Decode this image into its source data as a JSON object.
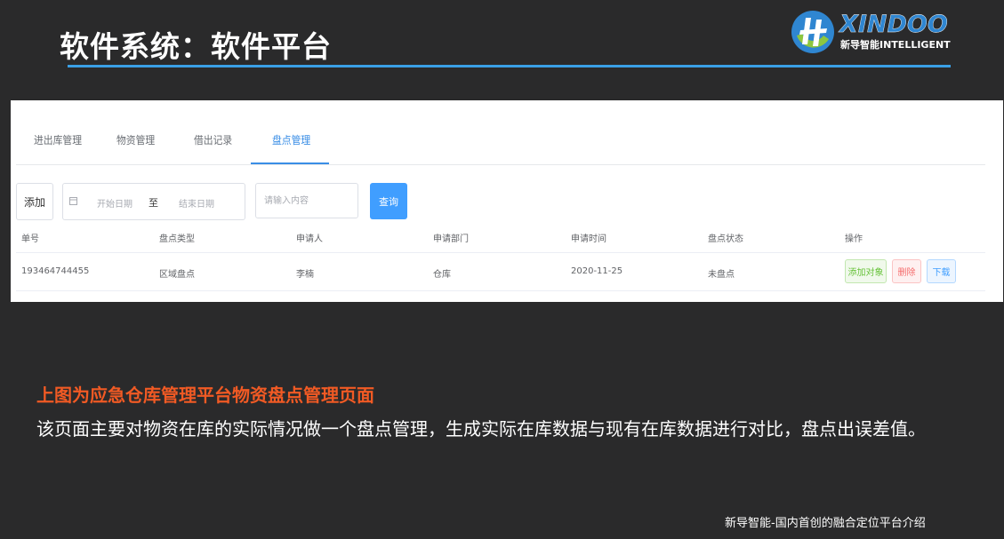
{
  "slide": {
    "title": "软件系统：软件平台",
    "caption_title": "上图为应急仓库管理平台物资盘点管理页面",
    "caption_body": "该页面主要对物资在库的实际情况做一个盘点管理，生成实际在库数据与现有在库数据进行对比，盘点出误差值。",
    "footer": "新导智能-国内首创的融合定位平台介绍"
  },
  "logo": {
    "brand": "XINDOO",
    "sub": "新导智能INTELLIGENT"
  },
  "tabs": [
    {
      "label": "进出库管理"
    },
    {
      "label": "物资管理"
    },
    {
      "label": "借出记录"
    },
    {
      "label": "盘点管理"
    }
  ],
  "toolbar": {
    "add_label": "添加",
    "date_start_placeholder": "开始日期",
    "date_separator": "至",
    "date_end_placeholder": "结束日期",
    "search_placeholder": "请输入内容",
    "query_label": "查询"
  },
  "table": {
    "columns": [
      "单号",
      "盘点类型",
      "申请人",
      "申请部门",
      "申请时间",
      "盘点状态",
      "操作"
    ],
    "rows": [
      {
        "cells": [
          "193464744455",
          "区域盘点",
          "李楠",
          "仓库",
          "2020-11-25",
          "未盘点"
        ],
        "actions": [
          "添加对象",
          "删除",
          "下载"
        ]
      }
    ]
  },
  "colors": {
    "accent": "#409eff",
    "title_underline": "#3aa0e6",
    "caption_title": "#f15a24",
    "background": "#2a2a2b"
  }
}
